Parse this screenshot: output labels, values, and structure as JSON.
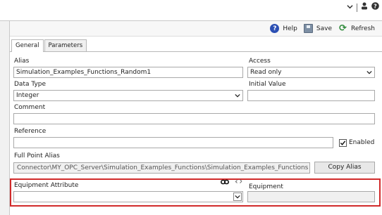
{
  "topbar": {
    "icons": [
      "chevron-down-icon",
      "user-icon",
      "help-icon"
    ]
  },
  "toolbar": {
    "help_label": "Help",
    "save_label": "Save",
    "refresh_label": "Refresh"
  },
  "tabs": [
    {
      "label": "General",
      "active": true
    },
    {
      "label": "Parameters",
      "active": false
    }
  ],
  "form": {
    "alias_label": "Alias",
    "alias_value": "Simulation_Examples_Functions_Random1",
    "access_label": "Access",
    "access_value": "Read only",
    "data_type_label": "Data Type",
    "data_type_value": "Integer",
    "initial_value_label": "Initial Value",
    "initial_value_value": "",
    "comment_label": "Comment",
    "comment_value": "",
    "reference_label": "Reference",
    "reference_value": "",
    "enabled_label": "Enabled",
    "enabled_checked": true,
    "full_point_alias_label": "Full Point Alias",
    "full_point_alias_value": "Connector\\MY_OPC_Server\\Simulation_Examples_Functions\\Simulation_Examples_Functions",
    "copy_alias_label": "Copy Alias",
    "equipment_attribute_label": "Equipment Attribute",
    "equipment_attribute_value": "",
    "equipment_label": "Equipment",
    "equipment_value": ""
  },
  "colors": {
    "highlight_border": "#d12a2a",
    "help_icon": "#2b4fb3",
    "refresh_icon": "#2d8a3a"
  }
}
